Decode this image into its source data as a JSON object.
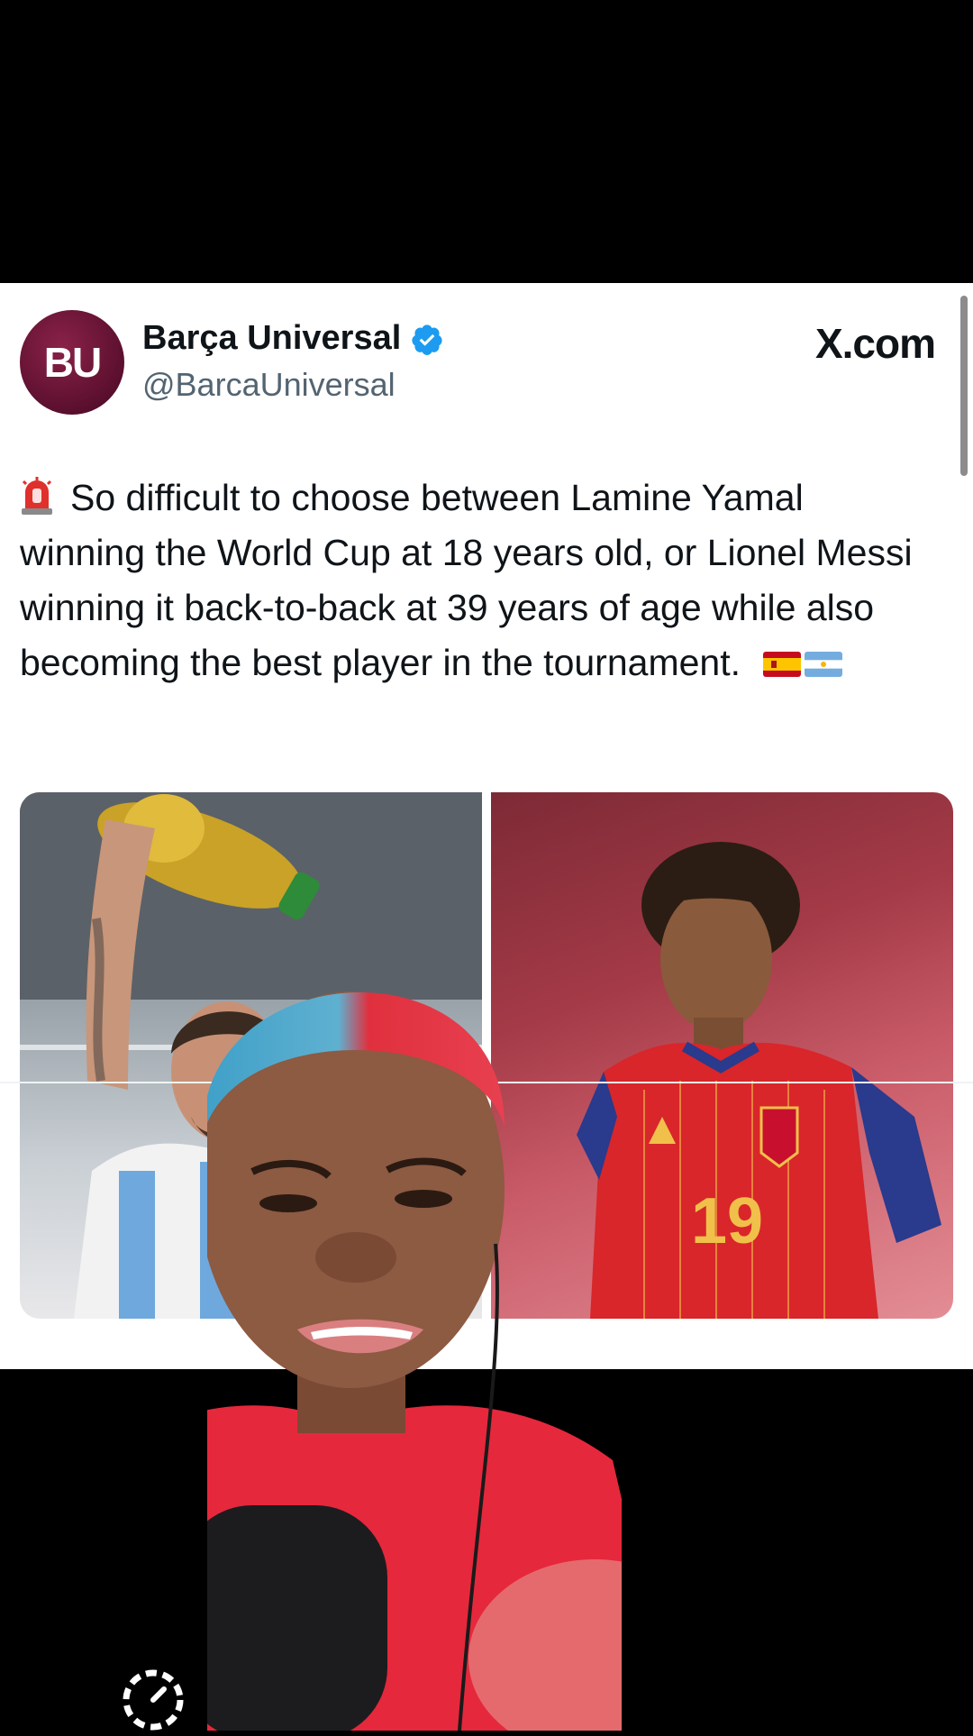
{
  "tweet": {
    "avatar_text": "BU",
    "display_name": "Barça Universal",
    "handle": "@BarcaUniversal",
    "site_badge": "X.com",
    "text": "So difficult to choose between Lamine Yamal winning the World Cup at 18 years old, or Lionel Messi winning it back-to-back at 39 years of age while also becoming the best player in the tournament.",
    "leading_icon": "siren-emoji-icon",
    "trailing_icons": [
      "spain-flag-icon",
      "argentina-flag-icon"
    ]
  },
  "media": {
    "images": [
      {
        "name": "messi-world-cup-photo",
        "jersey_text": ""
      },
      {
        "name": "yamal-spain-photo",
        "jersey_number": "19"
      }
    ]
  },
  "overlay": {
    "icon": "loading-timer-icon"
  },
  "colors": {
    "verified_blue": "#1d9bf0",
    "handle_gray": "#536471",
    "text_dark": "#0f1419",
    "avatar_maroon": "#6b1435"
  }
}
